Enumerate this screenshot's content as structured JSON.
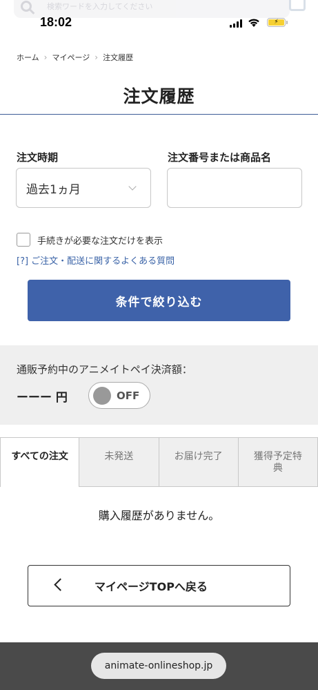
{
  "status_bar": {
    "time": "18:02"
  },
  "search_overlay": {
    "placeholder": "検索ワードを入力してください"
  },
  "breadcrumb": {
    "items": [
      "ホーム",
      "マイページ",
      "注文履歴"
    ],
    "separator": "›"
  },
  "page_title": "注文履歴",
  "filters": {
    "period_label": "注文時期",
    "period_value": "過去1ヵ月",
    "keyword_label": "注文番号または商品名",
    "keyword_value": "",
    "checkbox_label": "手続きが必要な注文だけを表示",
    "faq_link": "[?] ご注文・配送に関するよくある質問",
    "submit_label": "条件で絞り込む"
  },
  "animate_pay": {
    "label": "通販予約中のアニメイトペイ決済額：",
    "amount": "ーーー 円",
    "toggle_label": "OFF"
  },
  "tabs": [
    {
      "label": "すべての注文",
      "active": true
    },
    {
      "label": "未発送",
      "active": false
    },
    {
      "label": "お届け完了",
      "active": false
    },
    {
      "label": "獲得予定特典",
      "active": false
    }
  ],
  "empty_message": "購入履歴がありません。",
  "back_button": {
    "label": "マイページTOPへ戻る"
  },
  "browser": {
    "url": "animate-onlineshop.jp"
  },
  "colors": {
    "primary": "#3f62aa",
    "link": "#3a63a7",
    "panel": "#efefef",
    "battery": "#f6d033"
  }
}
